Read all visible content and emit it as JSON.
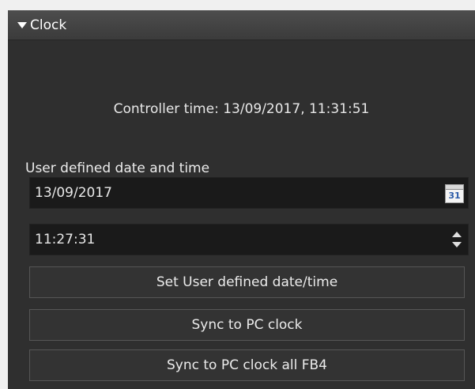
{
  "panel": {
    "title": "Clock",
    "expand_icon": "triangle-down-icon"
  },
  "controller_time": "Controller time: 13/09/2017, 11:31:51",
  "user_defined": {
    "label": "User defined date and time",
    "date_value": "13/09/2017",
    "calendar_icon": "calendar-icon",
    "calendar_icon_text": "31",
    "time_value": "11:27:31",
    "spinner_icon": "up-down-spinner-icon"
  },
  "buttons": {
    "set_label": "Set User defined date/time",
    "sync_label": "Sync to PC clock",
    "sync_all_label": "Sync to PC clock all FB4"
  },
  "colors": {
    "panel_background": "#2f2f2f",
    "field_background": "#1a1a1a",
    "text": "#ececec",
    "calendar_number": "#2a5aa8"
  }
}
